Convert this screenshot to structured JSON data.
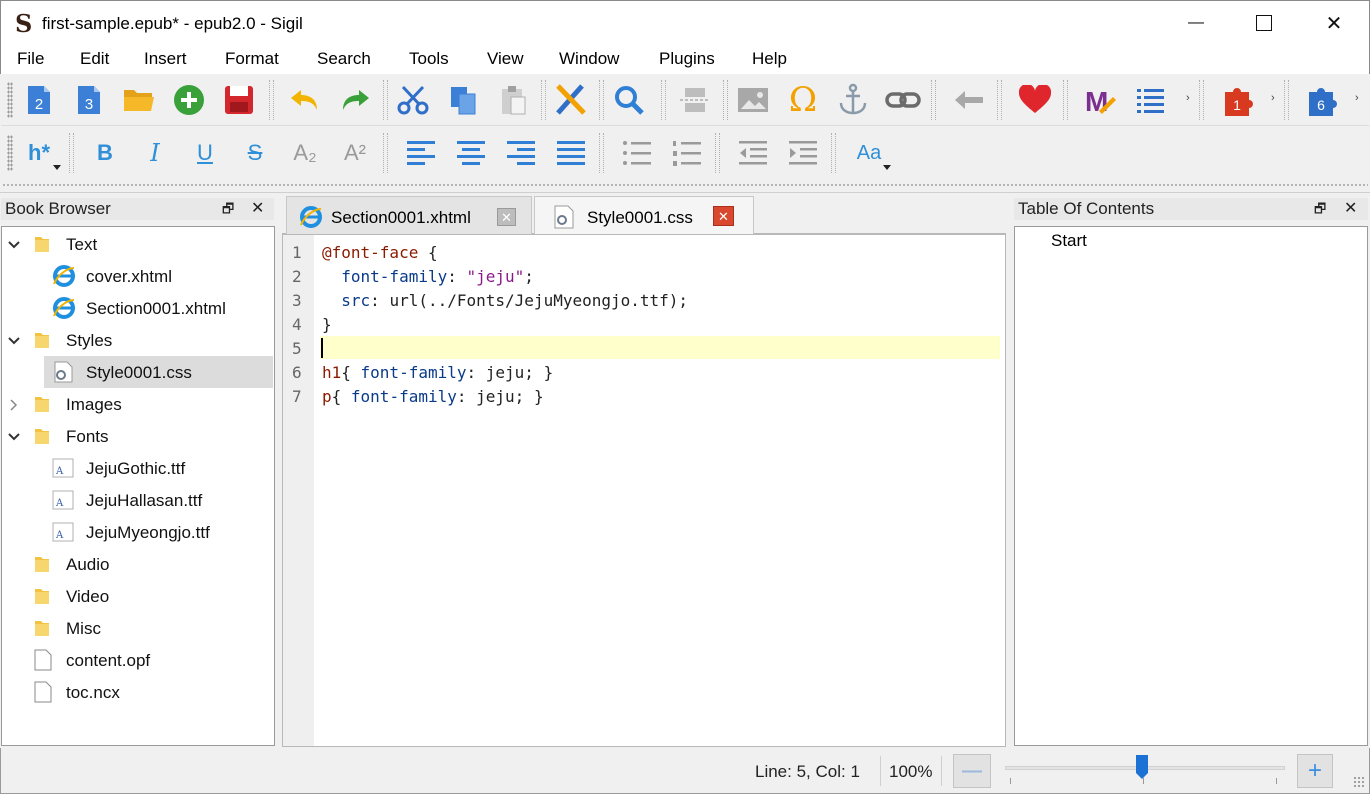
{
  "window": {
    "title": "first-sample.epub* - epub2.0 - Sigil",
    "logo_text": "S",
    "minimize_glyph": "—",
    "maximize_glyph": "☐",
    "close_glyph": "✕"
  },
  "menu": [
    "File",
    "Edit",
    "Insert",
    "Format",
    "Search",
    "Tools",
    "View",
    "Window",
    "Plugins",
    "Help"
  ],
  "toolbar1": {
    "icons": [
      "book-view-icon-2",
      "code-view-icon-3",
      "open-folder-icon",
      "add-file-icon",
      "save-icon",
      "undo-icon",
      "redo-icon",
      "cut-icon",
      "copy-icon",
      "paste-icon",
      "validate-icon",
      "find-icon",
      "insert-pagebreak-icon",
      "insert-image-icon",
      "special-char-icon",
      "anchor-icon",
      "link-icon",
      "back-icon",
      "donate-heart-icon",
      "metadata-editor-icon",
      "toc-editor-icon",
      "plugin-1-icon",
      "plugin-6-icon"
    ],
    "book_view_badge": "2",
    "code_view_badge": "3",
    "plugin1_badge": "1",
    "plugin6_badge": "6",
    "omega": "Ω",
    "metadata_letter": "M"
  },
  "toolbar2": {
    "heading": "h*",
    "bold": "B",
    "italic": "I",
    "underline": "U",
    "strike": "S",
    "subscript": "A₂",
    "superscript": "A²",
    "case": "Aa"
  },
  "book_browser": {
    "title": "Book Browser",
    "items": [
      {
        "label": "Text",
        "type": "folder",
        "expanded": true,
        "level": 0
      },
      {
        "label": "cover.xhtml",
        "type": "xhtml",
        "level": 1
      },
      {
        "label": "Section0001.xhtml",
        "type": "xhtml",
        "level": 1
      },
      {
        "label": "Styles",
        "type": "folder",
        "expanded": true,
        "level": 0
      },
      {
        "label": "Style0001.css",
        "type": "css",
        "level": 1,
        "selected": true
      },
      {
        "label": "Images",
        "type": "folder",
        "expanded": false,
        "level": 0
      },
      {
        "label": "Fonts",
        "type": "folder",
        "expanded": true,
        "level": 0
      },
      {
        "label": "JejuGothic.ttf",
        "type": "font",
        "level": 1
      },
      {
        "label": "JejuHallasan.ttf",
        "type": "font",
        "level": 1
      },
      {
        "label": "JejuMyeongjo.ttf",
        "type": "font",
        "level": 1
      },
      {
        "label": "Audio",
        "type": "folder",
        "level": 0
      },
      {
        "label": "Video",
        "type": "folder",
        "level": 0
      },
      {
        "label": "Misc",
        "type": "folder",
        "level": 0
      },
      {
        "label": "content.opf",
        "type": "file",
        "level": 0
      },
      {
        "label": "toc.ncx",
        "type": "file",
        "level": 0
      }
    ]
  },
  "tabs": [
    {
      "label": "Section0001.xhtml",
      "active": false
    },
    {
      "label": "Style0001.css",
      "active": true
    }
  ],
  "editor": {
    "line_numbers": [
      "1",
      "2",
      "3",
      "4",
      "5",
      "6",
      "7"
    ],
    "lines": [
      [
        {
          "t": "@font-face",
          "c": "kw"
        },
        {
          "t": " {",
          "c": "plain"
        }
      ],
      [
        {
          "t": "  font-family",
          "c": "prop"
        },
        {
          "t": ": ",
          "c": "plain"
        },
        {
          "t": "\"jeju\"",
          "c": "str"
        },
        {
          "t": ";",
          "c": "plain"
        }
      ],
      [
        {
          "t": "  src",
          "c": "prop"
        },
        {
          "t": ": url(../Fonts/JejuMyeongjo.ttf);",
          "c": "plain"
        }
      ],
      [
        {
          "t": "}",
          "c": "plain"
        }
      ],
      [],
      [
        {
          "t": "h1",
          "c": "kw"
        },
        {
          "t": "{ ",
          "c": "plain"
        },
        {
          "t": "font-family",
          "c": "prop"
        },
        {
          "t": ": jeju; }",
          "c": "plain"
        }
      ],
      [
        {
          "t": "p",
          "c": "kw"
        },
        {
          "t": "{ ",
          "c": "plain"
        },
        {
          "t": "font-family",
          "c": "prop"
        },
        {
          "t": ": jeju; }",
          "c": "plain"
        }
      ]
    ],
    "current_line": 5
  },
  "toc": {
    "title": "Table Of Contents",
    "items": [
      "Start"
    ]
  },
  "status": {
    "position": "Line: 5, Col: 1",
    "zoom": "100%",
    "zoom_out": "—",
    "zoom_in": "+",
    "zoom_slider_fraction": 0.49
  },
  "colors": {
    "accent_blue": "#2f8fd8",
    "current_line_bg": "#ffffcc",
    "selection_bg": "#dcdcdc",
    "tab_close_red": "#d9482e"
  }
}
